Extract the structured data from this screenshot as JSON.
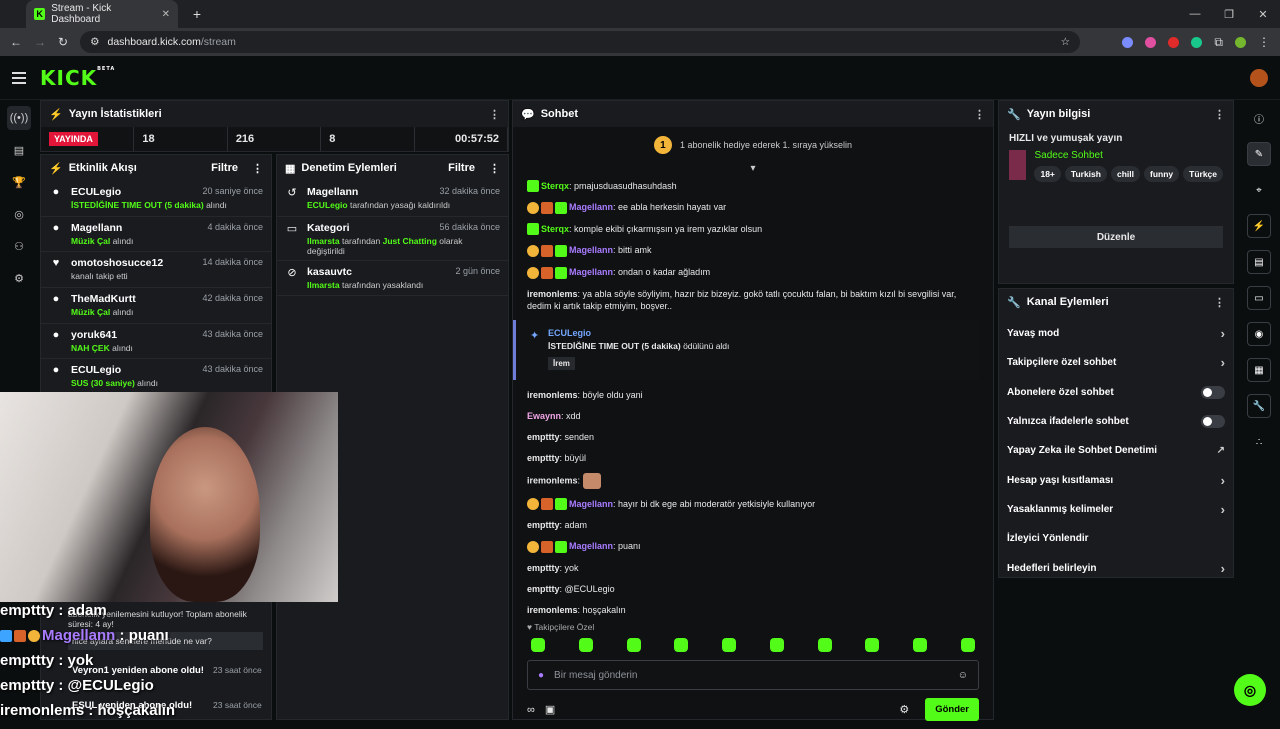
{
  "browser": {
    "tab_title": "Stream - Kick Dashboard",
    "url_host": "dashboard.kick.com",
    "url_path": "/stream"
  },
  "stats": {
    "title": "Yayın İstatistikleri",
    "live": "YAYINDA",
    "values": [
      "18",
      "216",
      "8",
      "00:57:52"
    ]
  },
  "activity": {
    "title": "Etkinlik Akışı",
    "filter": "Filtre",
    "items": [
      {
        "name": "ECULegio",
        "time": "20 saniye önce",
        "highlight": "İSTEDİĞİNE TIME OUT (5 dakika)",
        "rest": " alındı"
      },
      {
        "name": "Magellann",
        "time": "4 dakika önce",
        "highlight": "Müzik Çal",
        "rest": " alındı"
      },
      {
        "name": "omotoshosucce12",
        "time": "14 dakika önce",
        "highlight": "",
        "rest": "kanalı takip etti"
      },
      {
        "name": "TheMadKurtt",
        "time": "42 dakika önce",
        "highlight": "Müzik Çal",
        "rest": " alındı"
      },
      {
        "name": "yoruk641",
        "time": "43 dakika önce",
        "highlight": "NAH ÇEK",
        "rest": " alındı"
      },
      {
        "name": "ECULegio",
        "time": "43 dakika önce",
        "highlight": "SUS (30 saniye)",
        "rest": " alındı"
      }
    ]
  },
  "moderation": {
    "title": "Denetim Eylemleri",
    "filter": "Filtre",
    "items": [
      {
        "name": "Magellann",
        "time": "32 dakika önce",
        "actor": "ECULegio",
        "text": " tarafından yasağı kaldırıldı"
      },
      {
        "name": "Kategori",
        "time": "56 dakika önce",
        "actor": "Ilmarsta",
        "text": " tarafından ",
        "highlight": "Just Chatting",
        "text2": " olarak değiştirildi"
      },
      {
        "name": "kasauvtc",
        "time": "2 gün önce",
        "actor": "Ilmarsta",
        "text": " tarafından yasaklandı"
      }
    ]
  },
  "overlay": {
    "lines": [
      {
        "user": "empttty",
        "msg": "adam"
      },
      {
        "user": "Magellann",
        "msg": "puanı"
      },
      {
        "user": "empttty",
        "msg": "yok"
      },
      {
        "user": "empttty",
        "msg": "@ECULegio"
      },
      {
        "user": "iremonlems",
        "msg": "hoşçakalın"
      }
    ],
    "sub1": "abonelik yenilemesini kutluyor! Toplam abonelik süresi: 4 ay!",
    "sub2": "nice aylara senelere menüde ne var?",
    "sub3_name": "Veyron1 yeniden abone oldu!",
    "sub3_time": "23 saat önce",
    "sub4_time": "23 saat önce",
    "sub4_text": "ESUL yeniden abone oldu!"
  },
  "chat": {
    "title": "Sohbet",
    "banner": "1 abonelik hediye ederek 1. sıraya yükselin",
    "coin": "1",
    "messages": [
      {
        "badges": [
          "b3"
        ],
        "user": "Sterqx",
        "cls": "ug",
        "text": "pmajusduasudhasuhdash"
      },
      {
        "badges": [
          "b1",
          "b2",
          "b3"
        ],
        "user": "Magellann",
        "cls": "uv",
        "text": "ee abla herkesin hayatı var"
      },
      {
        "badges": [
          "b3"
        ],
        "user": "Sterqx",
        "cls": "ug",
        "text": "komple ekibi çıkarmışsın ya irem yazıklar olsun"
      },
      {
        "badges": [
          "b1",
          "b2",
          "b3"
        ],
        "user": "Magellann",
        "cls": "uv",
        "text": "bitti amk"
      },
      {
        "badges": [
          "b1",
          "b2",
          "b3"
        ],
        "user": "Magellann",
        "cls": "uv",
        "text": "ondan o kadar ağladım"
      },
      {
        "badges": [],
        "user": "iremonlems",
        "cls": "u",
        "text": "ya abla söyle söyliyim, hazır biz bizeyiz. gokö tatlı çocuktu falan, bi baktım kızıl bi sevgilisi var, dedim ki artık takip etmiyim, boşver.."
      }
    ],
    "redeem": {
      "user": "ECULegio",
      "title": "İSTEDİĞİNE TIME OUT (5 dakika)",
      "suffix": " ödülünü aldı",
      "param": "İrem"
    },
    "messages2": [
      {
        "badges": [],
        "user": "iremonlems",
        "cls": "u",
        "text": "böyle oldu yani"
      },
      {
        "badges": [],
        "user": "Ewaynn",
        "cls": "up",
        "text": "xdd"
      },
      {
        "badges": [],
        "user": "empttty",
        "cls": "u",
        "text": "senden"
      },
      {
        "badges": [],
        "user": "empttty",
        "cls": "u",
        "text": "büyül"
      },
      {
        "badges": [],
        "user": "iremonlems",
        "cls": "u",
        "text": ""
      },
      {
        "badges": [
          "b1",
          "b2",
          "b3"
        ],
        "user": "Magellann",
        "cls": "uv",
        "text": "hayır bi dk ege abi moderatör yetkisiyle kullanıyor"
      },
      {
        "badges": [],
        "user": "empttty",
        "cls": "u",
        "text": "adam"
      },
      {
        "badges": [
          "b1",
          "b2",
          "b3"
        ],
        "user": "Magellann",
        "cls": "uv",
        "text": "puanı"
      },
      {
        "badges": [],
        "user": "empttty",
        "cls": "u",
        "text": "yok"
      },
      {
        "badges": [],
        "user": "empttty",
        "cls": "u",
        "text": "@ECULegio"
      },
      {
        "badges": [],
        "user": "iremonlems",
        "cls": "u",
        "text": "hoşçakalın"
      }
    ],
    "followers_only": "Takipçilere Özel",
    "placeholder": "Bir mesaj gönderin",
    "send": "Gönder"
  },
  "info": {
    "title": "Yayın bilgisi",
    "stream_title": "HIZLI ve yumuşak yayın",
    "category": "Sadece Sohbet",
    "tags": [
      "18+",
      "Turkish",
      "chill",
      "funny",
      "Türkçe"
    ],
    "edit": "Düzenle"
  },
  "actions": {
    "title": "Kanal Eylemleri",
    "items": [
      {
        "label": "Yavaş mod",
        "ctl": "chev"
      },
      {
        "label": "Takipçilere özel sohbet",
        "ctl": "chev"
      },
      {
        "label": "Abonelere özel sohbet",
        "ctl": "toggle"
      },
      {
        "label": "Yalnızca ifadelerle sohbet",
        "ctl": "toggle"
      },
      {
        "label": "Yapay Zeka ile Sohbet Denetimi",
        "ctl": "ext"
      },
      {
        "label": "Hesap yaşı kısıtlaması",
        "ctl": "chev"
      },
      {
        "label": "Yasaklanmış kelimeler",
        "ctl": "chev"
      },
      {
        "label": "İzleyici Yönlendir",
        "ctl": ""
      },
      {
        "label": "Hedefleri belirleyin",
        "ctl": "chev"
      }
    ]
  },
  "colors": {
    "accent": "#53fc18",
    "live": "#e3163a",
    "mod": "#a97cff"
  }
}
